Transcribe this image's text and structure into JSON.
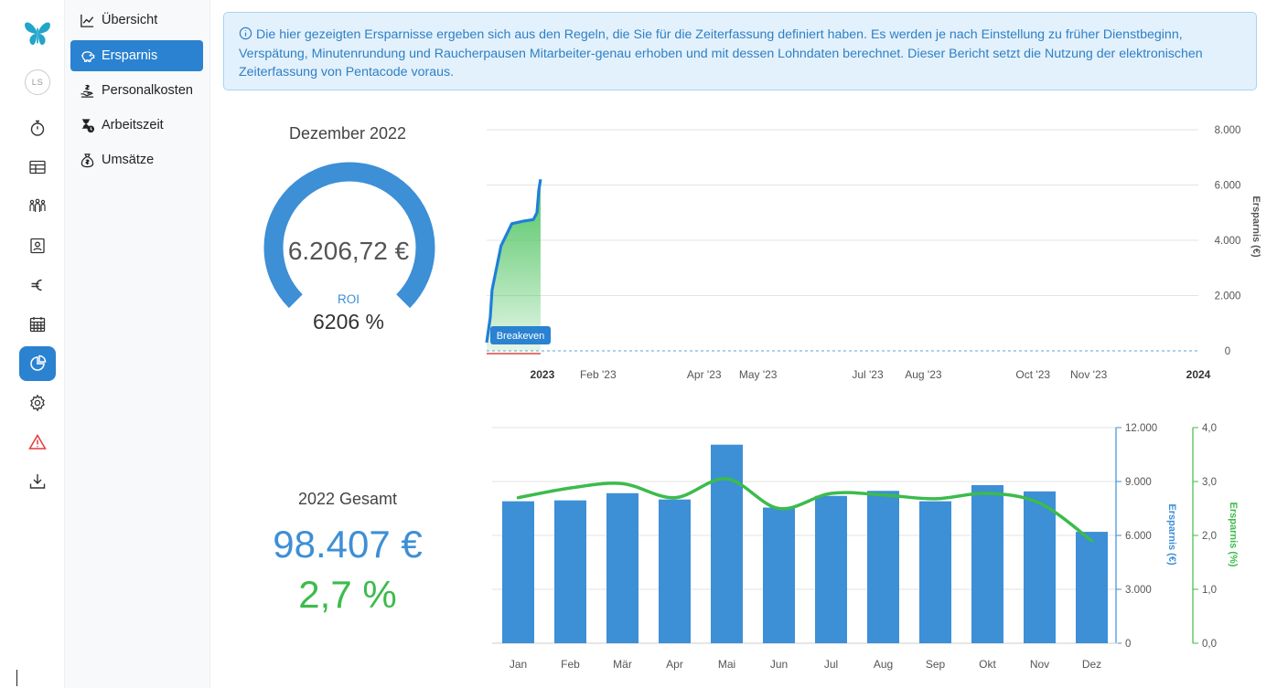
{
  "iconbar": {
    "user_initials": "LS",
    "items": [
      {
        "icon": "stopwatch-icon"
      },
      {
        "icon": "table-icon"
      },
      {
        "icon": "team-icon"
      },
      {
        "icon": "id-card-icon"
      },
      {
        "icon": "euro-icon"
      },
      {
        "icon": "calendar-icon"
      },
      {
        "icon": "pie-chart-icon",
        "active": true
      },
      {
        "icon": "gear-icon"
      },
      {
        "icon": "warning-icon"
      },
      {
        "icon": "download-icon"
      }
    ],
    "accent": "#2a82d0",
    "warning_color": "#e53935"
  },
  "subnav": {
    "items": [
      {
        "label": "Übersicht",
        "icon": "line-chart-icon"
      },
      {
        "label": "Ersparnis",
        "icon": "piggy-bank-icon",
        "active": true
      },
      {
        "label": "Personalkosten",
        "icon": "hand-money-icon"
      },
      {
        "label": "Arbeitszeit",
        "icon": "hourglass-icon"
      },
      {
        "label": "Umsätze",
        "icon": "money-bag-icon"
      }
    ]
  },
  "info": {
    "text": "Die hier gezeigten Ersparnisse ergeben sich aus den Regeln, die Sie für die Zeiterfassung definiert haben. Es werden je nach Einstellung zu früher Dienstbeginn, Verspätung, Minutenrundung und Raucherpausen Mitarbeiter-genau erhoben und mit dessen Lohndaten berechnet. Dieser Bericht setzt die Nutzung der elektronischen Zeiterfassung von Pentacode voraus."
  },
  "month_panel": {
    "title": "Dezember 2022",
    "amount": "6.206,72 €",
    "roi_label": "ROI",
    "roi_value": "6206 %",
    "gauge_fill": 1.0,
    "gauge_color": "#3d8fd6"
  },
  "year_panel": {
    "title": "2022 Gesamt",
    "amount": "98.407 €",
    "percent": "2,7 %",
    "amount_color": "#3d8fd6",
    "percent_color": "#3cbb4c"
  },
  "chart_data": [
    {
      "type": "area",
      "x_ticks": [
        {
          "label": "2023",
          "bold": true
        },
        {
          "label": "Feb '23"
        },
        {
          "label": "Apr '23"
        },
        {
          "label": "May '23"
        },
        {
          "label": "Jul '23"
        },
        {
          "label": "Aug '23"
        },
        {
          "label": "Oct '23"
        },
        {
          "label": "Nov '23"
        },
        {
          "label": "2024",
          "bold": true
        }
      ],
      "y_ticks": [
        "8.000",
        "6.000",
        "4.000",
        "2.000",
        "0"
      ],
      "ylabel": "Ersparnis (€)",
      "ylim": [
        0,
        8000
      ],
      "series": [
        {
          "x": [
            "2022-12-01",
            "2022-12-03",
            "2022-12-04",
            "2022-12-09",
            "2022-12-15",
            "2022-12-22",
            "2022-12-27",
            "2022-12-29",
            "2022-12-30",
            "2022-12-31"
          ],
          "y": [
            300,
            1200,
            2200,
            3800,
            4600,
            4700,
            4750,
            5000,
            5800,
            6207
          ],
          "color": "#1f7fd9",
          "fill": "#4cc35e"
        }
      ],
      "annotation": "Breakeven"
    },
    {
      "type": "bar",
      "categories": [
        "Jan",
        "Feb",
        "Mär",
        "Apr",
        "Mai",
        "Jun",
        "Jul",
        "Aug",
        "Sep",
        "Okt",
        "Nov",
        "Dez"
      ],
      "series": [
        {
          "name": "Ersparnis (€)",
          "type": "bar",
          "color": "#3d8fd6",
          "values": [
            7900,
            7950,
            8350,
            8000,
            11050,
            7550,
            8200,
            8480,
            7900,
            8800,
            8450,
            6200
          ]
        },
        {
          "name": "Ersparnis (%)",
          "type": "line",
          "color": "#3cbb4c",
          "values": [
            2.7,
            2.88,
            2.96,
            2.7,
            3.05,
            2.5,
            2.78,
            2.75,
            2.68,
            2.78,
            2.6,
            1.9
          ]
        }
      ],
      "y_ticks_left": [
        "12.000",
        "9.000",
        "6.000",
        "3.000",
        "0"
      ],
      "y_ticks_right": [
        "4,0",
        "3,0",
        "2,0",
        "1,0",
        "0,0"
      ],
      "ylabel_left": "Ersparnis (€)",
      "ylabel_right": "Ersparnis (%)",
      "ylim_left": [
        0,
        12000
      ],
      "ylim_right": [
        0,
        4
      ]
    }
  ]
}
